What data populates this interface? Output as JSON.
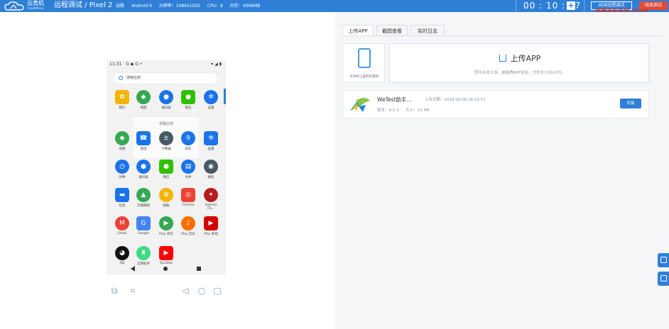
{
  "topbar": {
    "brand": "云真机",
    "brand_sub": "CloudPhone",
    "title": "远程调试 / Pixel 2",
    "specs": [
      "谷歌",
      "Android 9",
      "分辨率：1080x1920",
      "CPU：8",
      "内存：4096MB"
    ],
    "timer": "00 : 10 : 47",
    "adb_label": "ADB远程调试",
    "exit_label": "结束测试",
    "watermark": "屏幕录像专家 未注册",
    "plus_label": "+"
  },
  "phone": {
    "status_time": "11:31",
    "status_icons": "G  ◆ G  •",
    "status_right": "▾ ◢ ▮",
    "search_placeholder": "搜索应用",
    "folder_title": "将集应用",
    "apps": [
      {
        "label": "相片",
        "icon": "photos-icon",
        "color": "#f4b400",
        "glyph": "✿"
      },
      {
        "label": "地图",
        "icon": "maps-icon",
        "color": "#34a853",
        "glyph": "◆"
      },
      {
        "label": "通讯录",
        "icon": "contacts-icon",
        "color": "#1a73e8",
        "glyph": "●"
      },
      {
        "label": "微信",
        "icon": "wechat-icon",
        "color": "#2dc100",
        "glyph": "●"
      },
      {
        "label": "设置",
        "icon": "settings-icon",
        "color": "#1a73e8",
        "glyph": "✲"
      },
      {
        "label": "地图",
        "icon": "maps-icon",
        "color": "#34a853",
        "glyph": "◆"
      },
      {
        "label": "电话",
        "icon": "phone-icon",
        "color": "#1a73e8",
        "glyph": "☎"
      },
      {
        "label": "计算器",
        "icon": "calculator-icon",
        "color": "#455a64",
        "glyph": "±"
      },
      {
        "label": "日历",
        "icon": "calendar-icon",
        "color": "#1a73e8",
        "glyph": "9"
      },
      {
        "label": "设置",
        "icon": "settings-icon",
        "color": "#1a73e8",
        "glyph": "✲"
      },
      {
        "label": "时钟",
        "icon": "clock-icon",
        "color": "#1a73e8",
        "glyph": "◷"
      },
      {
        "label": "通讯录",
        "icon": "contacts-icon",
        "color": "#1a73e8",
        "glyph": "●"
      },
      {
        "label": "微信",
        "icon": "wechat-icon",
        "color": "#2dc100",
        "glyph": "●"
      },
      {
        "label": "文件",
        "icon": "files-icon",
        "color": "#1a73e8",
        "glyph": "▤"
      },
      {
        "label": "相机",
        "icon": "camera-icon",
        "color": "#455a64",
        "glyph": "◉"
      },
      {
        "label": "信息",
        "icon": "messages-icon",
        "color": "#1a73e8",
        "glyph": "▬"
      },
      {
        "label": "云端硬盘",
        "icon": "drive-icon",
        "color": "#34a853",
        "glyph": "▲"
      },
      {
        "label": "相册",
        "icon": "photos-icon",
        "color": "#f4b400",
        "glyph": "✿"
      },
      {
        "label": "Chrome",
        "icon": "chrome-icon",
        "color": "#ea4335",
        "glyph": "◎"
      },
      {
        "label": "Samsta (Ta...",
        "icon": "samsta-icon",
        "color": "#b71c1c",
        "glyph": "✦"
      },
      {
        "label": "Gmail",
        "icon": "gmail-icon",
        "color": "#ea4335",
        "glyph": "M"
      },
      {
        "label": "Google",
        "icon": "google-icon",
        "color": "#4285f4",
        "glyph": "G"
      },
      {
        "label": "Play 商店",
        "icon": "play-store-icon",
        "color": "#34a853",
        "glyph": "▶"
      },
      {
        "label": "Play 音乐",
        "icon": "play-music-icon",
        "color": "#ff6d00",
        "glyph": "♪"
      },
      {
        "label": "Play 影视",
        "icon": "play-movies-icon",
        "color": "#d50000",
        "glyph": "▶"
      },
      {
        "label": "QQ",
        "icon": "qq-icon",
        "color": "#111111",
        "glyph": "◕"
      },
      {
        "label": "王牌助手",
        "icon": "android-app-icon",
        "color": "#3ddc84",
        "glyph": "♜"
      },
      {
        "label": "YouTube",
        "icon": "youtube-icon",
        "color": "#ff0000",
        "glyph": "▶"
      }
    ]
  },
  "right": {
    "tabs": [
      "上传APP",
      "截图查看",
      "实时日志"
    ],
    "upload_caption": "在手机上操作云真机",
    "upload_title": "上传APP",
    "upload_hint": "您可点击上传，或拖拽APP至此。文件大小3G以内。",
    "app_card": {
      "name": "WeTest助手...",
      "date": "上传日期：2018-09-08 16:31:57",
      "version": "版本：4.5.3",
      "size": "大小：10.5M",
      "install_label": "安装"
    }
  }
}
